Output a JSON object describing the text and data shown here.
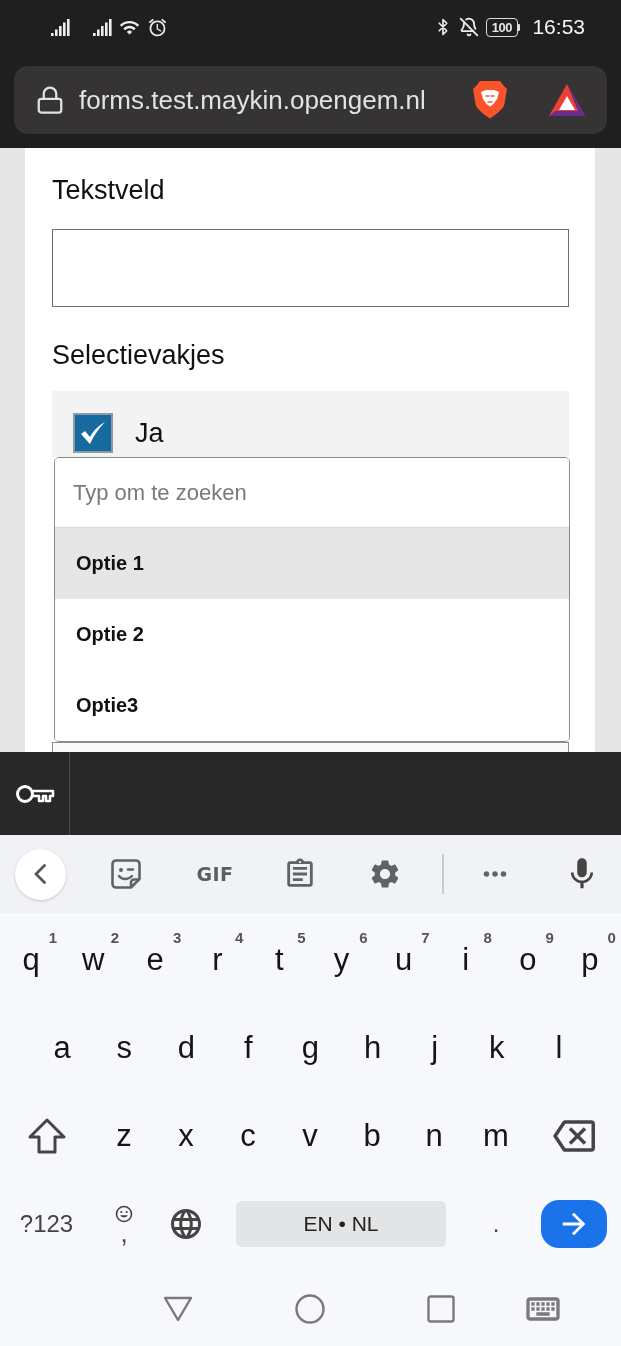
{
  "status_bar": {
    "battery": "100",
    "time": "16:53"
  },
  "address_bar": {
    "url": "forms.test.maykin.opengem.nl"
  },
  "form": {
    "text_field": {
      "label": "Tekstveld"
    },
    "checkbox_group": {
      "label": "Selectievakjes",
      "options": [
        {
          "label": "Ja",
          "checked": true
        }
      ]
    },
    "dropdown": {
      "placeholder": "Typ om te zoeken",
      "options": [
        {
          "label": "Optie 1",
          "selected": true
        },
        {
          "label": "Optie 2",
          "selected": false
        },
        {
          "label": "Optie3",
          "selected": false
        }
      ]
    }
  },
  "keyboard": {
    "toolbar": {
      "gif": "GIF"
    },
    "rows": [
      {
        "keys": [
          {
            "kind": "letter",
            "label": "q",
            "hint": "1"
          },
          {
            "kind": "letter",
            "label": "w",
            "hint": "2"
          },
          {
            "kind": "letter",
            "label": "e",
            "hint": "3"
          },
          {
            "kind": "letter",
            "label": "r",
            "hint": "4"
          },
          {
            "kind": "letter",
            "label": "t",
            "hint": "5"
          },
          {
            "kind": "letter",
            "label": "y",
            "hint": "6"
          },
          {
            "kind": "letter",
            "label": "u",
            "hint": "7"
          },
          {
            "kind": "letter",
            "label": "i",
            "hint": "8"
          },
          {
            "kind": "letter",
            "label": "o",
            "hint": "9"
          },
          {
            "kind": "letter",
            "label": "p",
            "hint": "0"
          }
        ]
      },
      {
        "keys": [
          {
            "kind": "letter",
            "label": "a"
          },
          {
            "kind": "letter",
            "label": "s"
          },
          {
            "kind": "letter",
            "label": "d"
          },
          {
            "kind": "letter",
            "label": "f"
          },
          {
            "kind": "letter",
            "label": "g"
          },
          {
            "kind": "letter",
            "label": "h"
          },
          {
            "kind": "letter",
            "label": "j"
          },
          {
            "kind": "letter",
            "label": "k"
          },
          {
            "kind": "letter",
            "label": "l"
          }
        ]
      },
      {
        "keys": [
          {
            "kind": "shift"
          },
          {
            "kind": "letter",
            "label": "z"
          },
          {
            "kind": "letter",
            "label": "x"
          },
          {
            "kind": "letter",
            "label": "c"
          },
          {
            "kind": "letter",
            "label": "v"
          },
          {
            "kind": "letter",
            "label": "b"
          },
          {
            "kind": "letter",
            "label": "n"
          },
          {
            "kind": "letter",
            "label": "m"
          },
          {
            "kind": "backspace"
          }
        ]
      },
      {
        "keys": [
          {
            "kind": "symbols",
            "label": "?123"
          },
          {
            "kind": "comma",
            "label": ","
          },
          {
            "kind": "globe"
          },
          {
            "kind": "space",
            "label": "EN • NL"
          },
          {
            "kind": "period",
            "label": "."
          },
          {
            "kind": "enter"
          }
        ]
      }
    ]
  }
}
